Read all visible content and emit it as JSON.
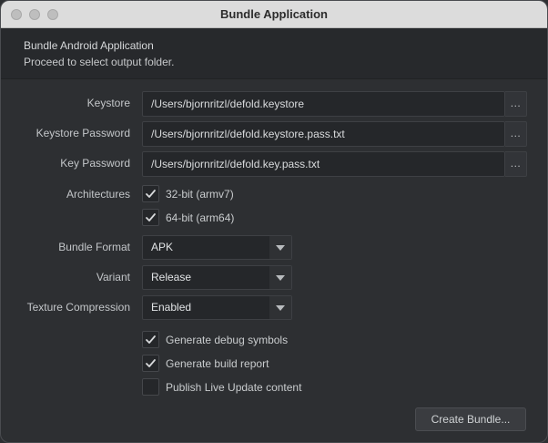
{
  "window": {
    "title": "Bundle Application"
  },
  "header": {
    "title": "Bundle Android Application",
    "subtitle": "Proceed to select output folder."
  },
  "form": {
    "keystore": {
      "label": "Keystore",
      "value": "/Users/bjornritzl/defold.keystore",
      "browse": "..."
    },
    "keystore_password": {
      "label": "Keystore Password",
      "value": "/Users/bjornritzl/defold.keystore.pass.txt",
      "browse": "..."
    },
    "key_password": {
      "label": "Key Password",
      "value": "/Users/bjornritzl/defold.key.pass.txt",
      "browse": "..."
    },
    "architectures": {
      "label": "Architectures",
      "options": [
        {
          "label": "32-bit (armv7)",
          "checked": true
        },
        {
          "label": "64-bit (arm64)",
          "checked": true
        }
      ]
    },
    "bundle_format": {
      "label": "Bundle Format",
      "value": "APK"
    },
    "variant": {
      "label": "Variant",
      "value": "Release"
    },
    "texture_compression": {
      "label": "Texture Compression",
      "value": "Enabled"
    },
    "options": [
      {
        "label": "Generate debug symbols",
        "checked": true
      },
      {
        "label": "Generate build report",
        "checked": true
      },
      {
        "label": "Publish Live Update content",
        "checked": false
      }
    ]
  },
  "actions": {
    "create_bundle": "Create Bundle..."
  }
}
